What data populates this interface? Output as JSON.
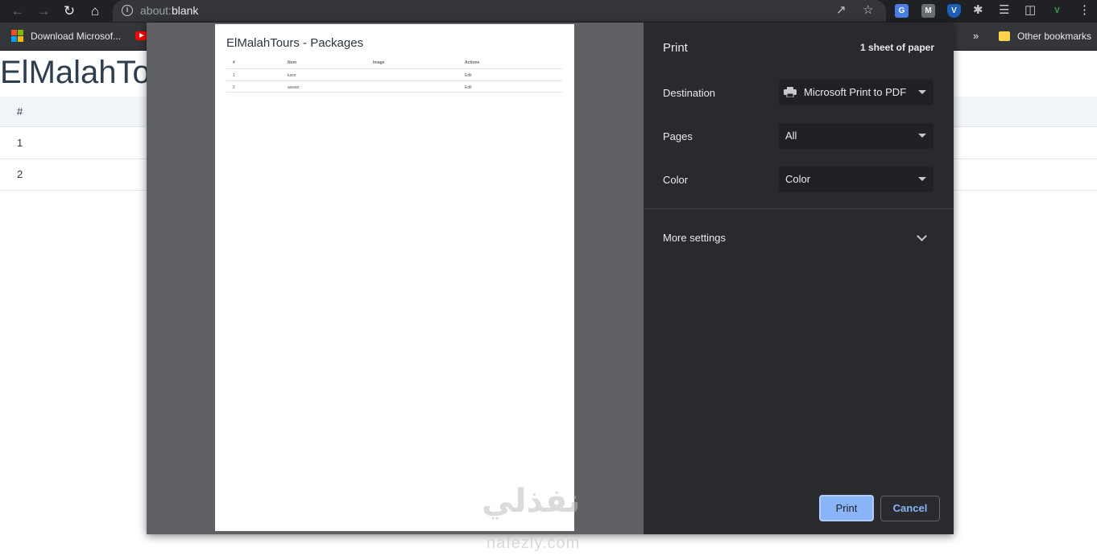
{
  "browser": {
    "url_scheme": "about:",
    "url_host": "blank",
    "bookmarks": {
      "download_label": "Download Microsof...",
      "other_label": "Other bookmarks",
      "overflow": "»"
    }
  },
  "page": {
    "title": "ElMalahTo",
    "table": {
      "header": "#",
      "rows": [
        "1",
        "2"
      ]
    }
  },
  "print_preview": {
    "title": "ElMalahTours - Packages",
    "columns": [
      "#",
      "Nom",
      "Image",
      "Actions"
    ],
    "rows": [
      [
        "1",
        "luxor",
        "",
        "Edit"
      ],
      [
        "2",
        "aswan",
        "",
        "Edit"
      ]
    ]
  },
  "print_panel": {
    "title": "Print",
    "sheet_count": "1 sheet of paper",
    "destination_label": "Destination",
    "destination_value": "Microsoft Print to PDF",
    "pages_label": "Pages",
    "pages_value": "All",
    "color_label": "Color",
    "color_value": "Color",
    "more_settings": "More settings",
    "print_button": "Print",
    "cancel_button": "Cancel"
  },
  "watermark": {
    "arabic": "نفذلي",
    "latin": "nafezly.com"
  }
}
